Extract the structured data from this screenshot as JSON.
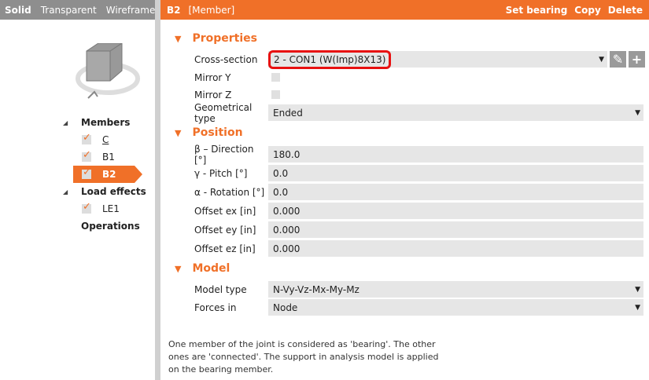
{
  "view_modes": [
    "Solid",
    "Transparent",
    "Wireframe"
  ],
  "header": {
    "title": "B2",
    "type": "[Member]",
    "actions": [
      "Set bearing",
      "Copy",
      "Delete"
    ]
  },
  "tree": {
    "members_label": "Members",
    "members": [
      "C",
      "B1",
      "B2"
    ],
    "load_effects_label": "Load effects",
    "load_effects": [
      "LE1"
    ],
    "operations_label": "Operations"
  },
  "properties": {
    "title": "Properties",
    "cross_section_label": "Cross-section",
    "cross_section": "2 - CON1 (W(Imp)8X13)",
    "mirror_y_label": "Mirror Y",
    "mirror_z_label": "Mirror Z",
    "geom_type_label": "Geometrical type",
    "geom_type": "Ended"
  },
  "position": {
    "title": "Position",
    "rows": [
      {
        "label": "β – Direction [°]",
        "value": "180.0"
      },
      {
        "label": "γ - Pitch [°]",
        "value": "0.0"
      },
      {
        "label": "α - Rotation [°]",
        "value": "0.0"
      },
      {
        "label": "Offset ex [in]",
        "value": "0.000"
      },
      {
        "label": "Offset ey [in]",
        "value": "0.000"
      },
      {
        "label": "Offset ez [in]",
        "value": "0.000"
      }
    ]
  },
  "model": {
    "title": "Model",
    "model_type_label": "Model type",
    "model_type": "N-Vy-Vz-Mx-My-Mz",
    "forces_in_label": "Forces in",
    "forces_in": "Node"
  },
  "footer": "One member of the joint is considered as 'bearing'. The other ones are 'connected'. The support in analysis model is applied on the bearing member.",
  "colors": {
    "accent": "#f07028",
    "highlight": "#e81010"
  }
}
